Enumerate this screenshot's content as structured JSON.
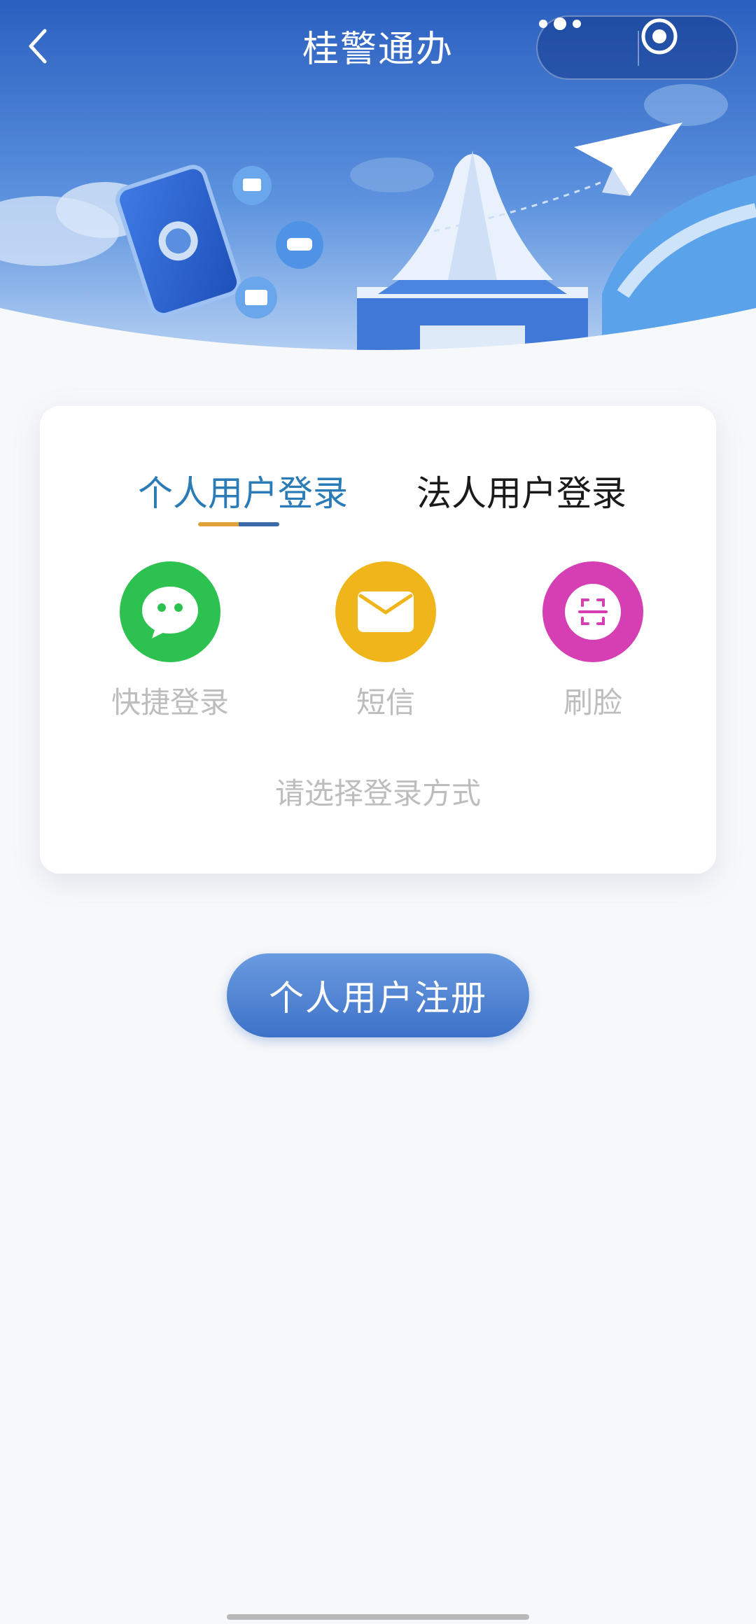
{
  "header": {
    "title": "桂警通办",
    "back_icon": "chevron-left-icon",
    "more_icon": "more-dots-icon",
    "close_icon": "target-circle-icon"
  },
  "login_card": {
    "tabs": [
      {
        "label": "个人用户登录",
        "active": true
      },
      {
        "label": "法人用户登录",
        "active": false
      }
    ],
    "methods": [
      {
        "label": "快捷登录",
        "icon": "wechat-icon",
        "color": "#2dc24f"
      },
      {
        "label": "短信",
        "icon": "envelope-icon",
        "color": "#f0b51a"
      },
      {
        "label": "刷脸",
        "icon": "face-scan-icon",
        "color": "#d63fb3"
      }
    ],
    "hint": "请选择登录方式"
  },
  "register_button": "个人用户注册",
  "colors": {
    "banner_blue": "#2f63c3",
    "active_tab": "#2a7bb6",
    "button_blue": "#4b80d0"
  }
}
